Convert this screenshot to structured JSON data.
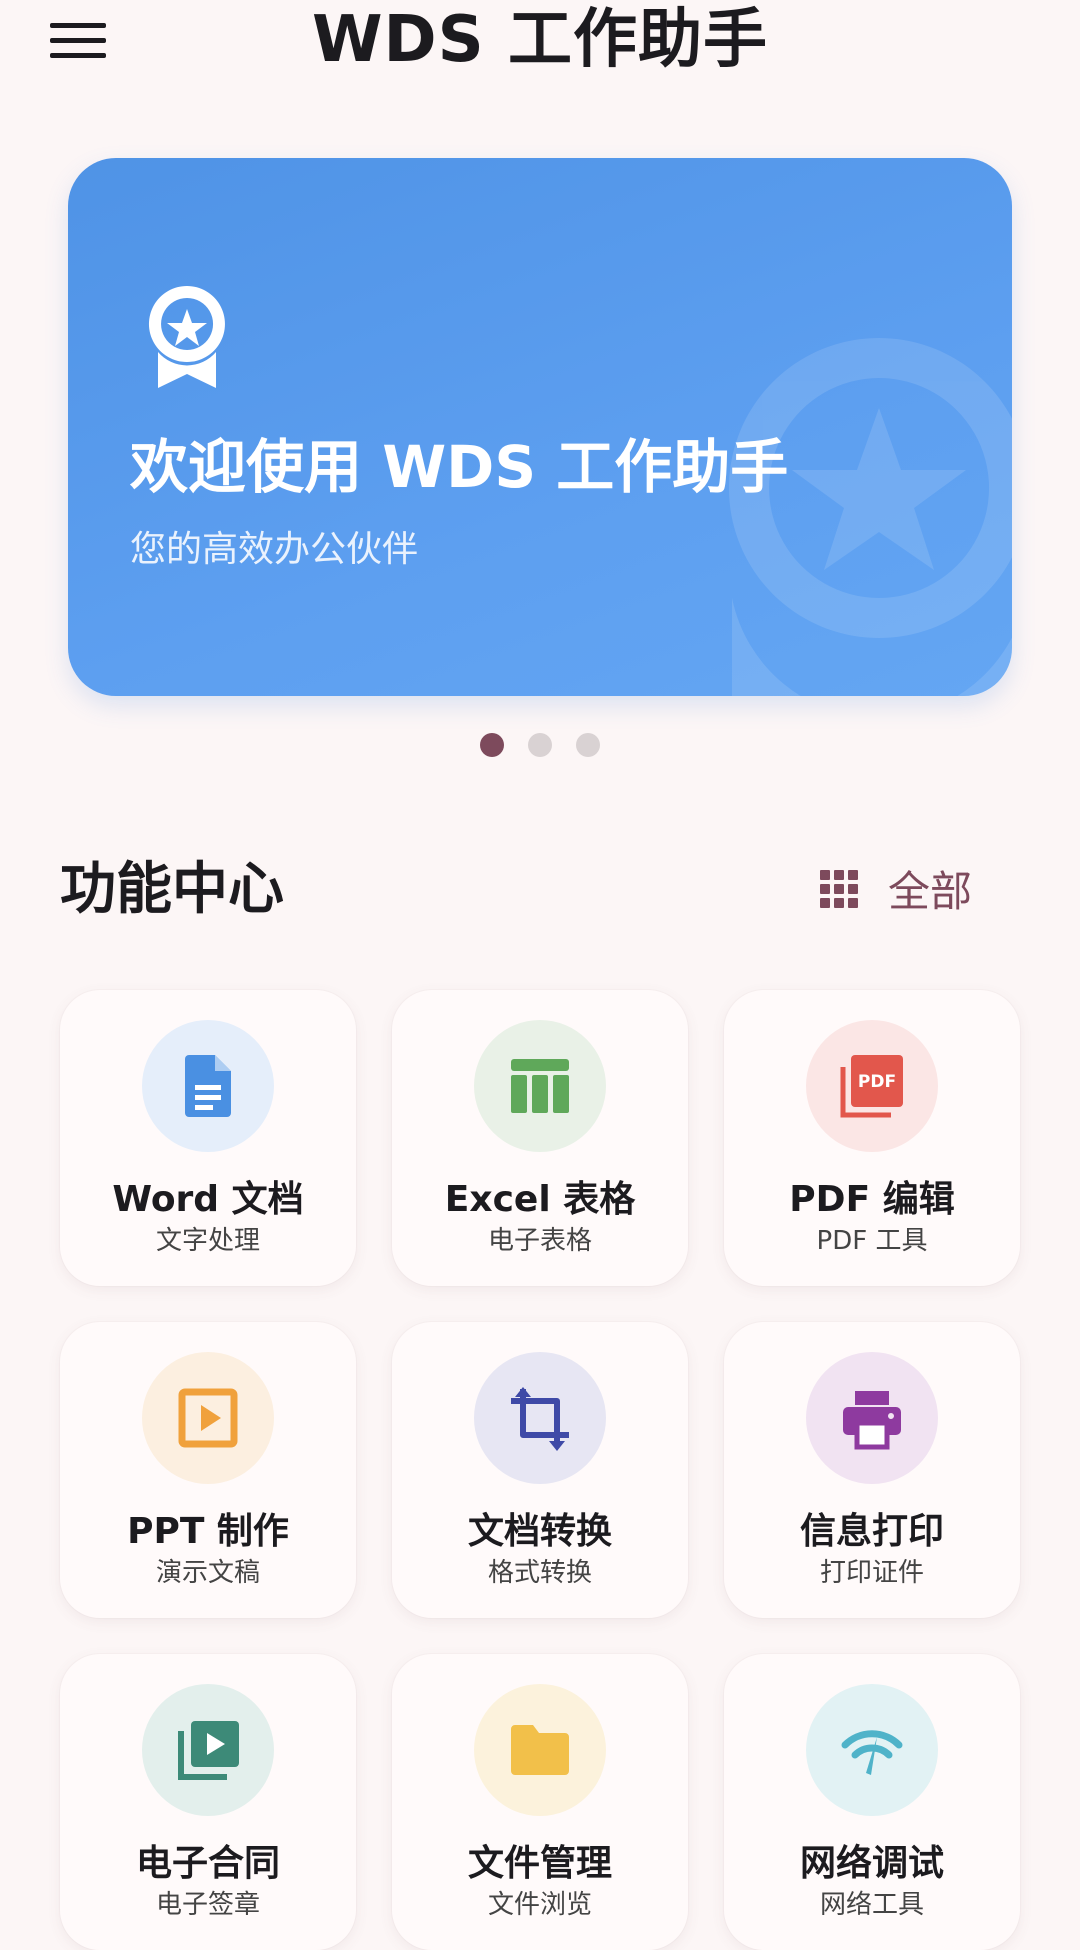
{
  "header": {
    "title": "WDS 工作助手"
  },
  "banner": {
    "title": "欢迎使用 WDS 工作助手",
    "subtitle": "您的高效办公伙伴",
    "active_page": 1,
    "page_count": 3
  },
  "section": {
    "title": "功能中心",
    "all_label": "全部"
  },
  "cards": [
    {
      "title": "Word 文档",
      "subtitle": "文字处理",
      "icon": "document-icon",
      "color": "#4a90e2",
      "bg": "#e5eefa"
    },
    {
      "title": "Excel 表格",
      "subtitle": "电子表格",
      "icon": "table-icon",
      "color": "#5fa85a",
      "bg": "#e9f1e7"
    },
    {
      "title": "PDF 编辑",
      "subtitle": "PDF 工具",
      "icon": "pdf-icon",
      "color": "#e2574c",
      "bg": "#fbe6e5"
    },
    {
      "title": "PPT 制作",
      "subtitle": "演示文稿",
      "icon": "slideshow-icon",
      "color": "#f0a13c",
      "bg": "#fcefe0"
    },
    {
      "title": "文档转换",
      "subtitle": "格式转换",
      "icon": "crop-rotate-icon",
      "color": "#3f4aa7",
      "bg": "#e7e6f3"
    },
    {
      "title": "信息打印",
      "subtitle": "打印证件",
      "icon": "printer-icon",
      "color": "#8e3a9f",
      "bg": "#f1e3f2"
    },
    {
      "title": "电子合同",
      "subtitle": "电子签章",
      "icon": "video-library-icon",
      "color": "#3d8a78",
      "bg": "#e3efec"
    },
    {
      "title": "文件管理",
      "subtitle": "文件浏览",
      "icon": "folder-icon",
      "color": "#f2c04a",
      "bg": "#fcf2dc"
    },
    {
      "title": "网络调试",
      "subtitle": "网络工具",
      "icon": "network-speed-icon",
      "color": "#4fb3c9",
      "bg": "#e2f2f4"
    }
  ]
}
